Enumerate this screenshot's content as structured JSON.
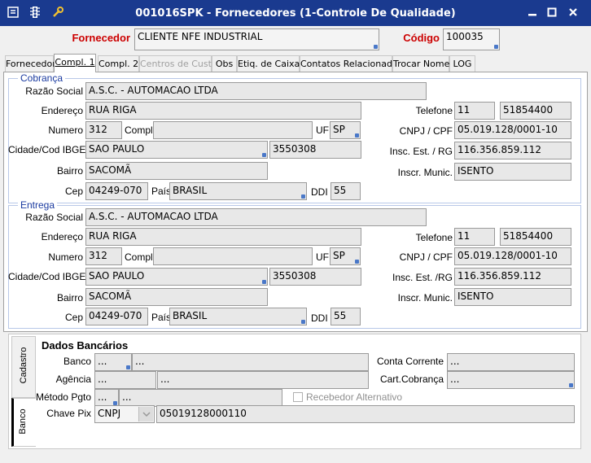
{
  "window": {
    "title": "001016SPK - Fornecedores (1-Controle De Qualidade)",
    "icons": [
      "menu-icon",
      "traffic-light-icon",
      "wrench-icon"
    ],
    "buttons": [
      "minimize",
      "maximize",
      "close"
    ]
  },
  "header": {
    "fornecedor_label": "Fornecedor",
    "fornecedor_value": "CLIENTE NFE INDUSTRIAL",
    "codigo_label": "Código",
    "codigo_value": "100035"
  },
  "tabs": [
    {
      "label": "Fornecedor",
      "state": "normal"
    },
    {
      "label": "Compl. 1",
      "state": "active"
    },
    {
      "label": "Compl. 2",
      "state": "normal"
    },
    {
      "label": "Centros de Custo",
      "state": "disabled"
    },
    {
      "label": "Obs",
      "state": "normal"
    },
    {
      "label": "Etiq. de Caixas",
      "state": "normal"
    },
    {
      "label": "Contatos Relacionados",
      "state": "normal"
    },
    {
      "label": "Trocar Nome",
      "state": "normal"
    },
    {
      "label": "LOG",
      "state": "normal"
    }
  ],
  "cobranca": {
    "group_title": "Cobrança",
    "razao_label": "Razão Social",
    "razao": "A.S.C. - AUTOMACAO LTDA",
    "endereco_label": "Endereço",
    "endereco": "RUA RIGA",
    "numero_label": "Numero",
    "numero": "312",
    "compl_label": "Compl.",
    "compl": "",
    "uf_label": "UF",
    "uf": "SP",
    "cidade_label": "Cidade/Cod IBGE",
    "cidade": "SAO PAULO",
    "ibge": "3550308",
    "bairro_label": "Bairro",
    "bairro": "SACOMÃ",
    "cep_label": "Cep",
    "cep": "04249-070",
    "pais_label": "País",
    "pais": "BRASIL",
    "ddi_label": "DDI",
    "ddi": "55",
    "telefone_label": "Telefone",
    "ddd": "11",
    "telefone": "51854400",
    "cnpj_label": "CNPJ / CPF",
    "cnpj": "05.019.128/0001-10",
    "insc_est_label": "Insc. Est. / RG",
    "insc_est": "116.356.859.112",
    "insc_mun_label": "Inscr. Munic.",
    "insc_mun": "ISENTO"
  },
  "entrega": {
    "group_title": "Entrega",
    "razao_label": "Razão Social",
    "razao": "A.S.C. - AUTOMACAO LTDA",
    "endereco_label": "Endereço",
    "endereco": "RUA RIGA",
    "numero_label": "Numero",
    "numero": "312",
    "compl_label": "Compl.",
    "compl": "",
    "uf_label": "UF",
    "uf": "SP",
    "cidade_label": "Cidade/Cod IBGE",
    "cidade": "SAO PAULO",
    "ibge": "3550308",
    "bairro_label": "Bairro",
    "bairro": "SACOMÃ",
    "cep_label": "Cep",
    "cep": "04249-070",
    "pais_label": "País",
    "pais": "BRASIL",
    "ddi_label": "DDI",
    "ddi": "55",
    "telefone_label": "Telefone",
    "ddd": "11",
    "telefone": "51854400",
    "cnpj_label": "CNPJ / CPF",
    "cnpj": "05.019.128/0001-10",
    "insc_est_label": "Insc. Est. /RG",
    "insc_est": "116.356.859.112",
    "insc_mun_label": "Inscr. Munic.",
    "insc_mun": "ISENTO"
  },
  "banco": {
    "vtab_cadastro": "Cadastro",
    "vtab_banco": "Banco",
    "title": "Dados Bancários",
    "banco_label": "Banco",
    "banco_code": "...",
    "banco_name": "...",
    "agencia_label": "Agência",
    "agencia_code": "...",
    "agencia_name": "...",
    "metodo_label": "Método Pgto",
    "metodo_code": "...",
    "metodo_name": "...",
    "chave_label": "Chave Pix",
    "chave_tipo": "CNPJ",
    "chave_valor": "05019128000110",
    "conta_label": "Conta Corrente",
    "conta": "...",
    "cart_label": "Cart.Cobrança",
    "cart": "...",
    "receb_label": "Recebedor Alternativo"
  }
}
